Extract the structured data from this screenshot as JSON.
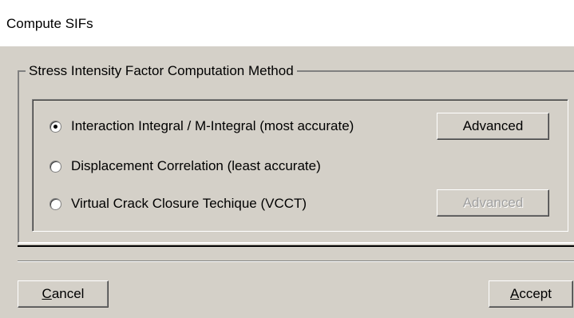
{
  "window": {
    "title": "Compute SIFs"
  },
  "group": {
    "label": "Stress Intensity Factor Computation Method"
  },
  "options": [
    {
      "label": "Interaction Integral / M-Integral (most accurate)",
      "checked": true,
      "advanced_label": "Advanced",
      "advanced_enabled": true
    },
    {
      "label": "Displacement Correlation (least accurate)",
      "checked": false
    },
    {
      "label": "Virtual Crack Closure Techique (VCCT)",
      "checked": false,
      "advanced_label": "Advanced",
      "advanced_enabled": false
    }
  ],
  "footer": {
    "cancel_first": "C",
    "cancel_rest": "ancel",
    "accept_first": "A",
    "accept_rest": "ccept"
  }
}
